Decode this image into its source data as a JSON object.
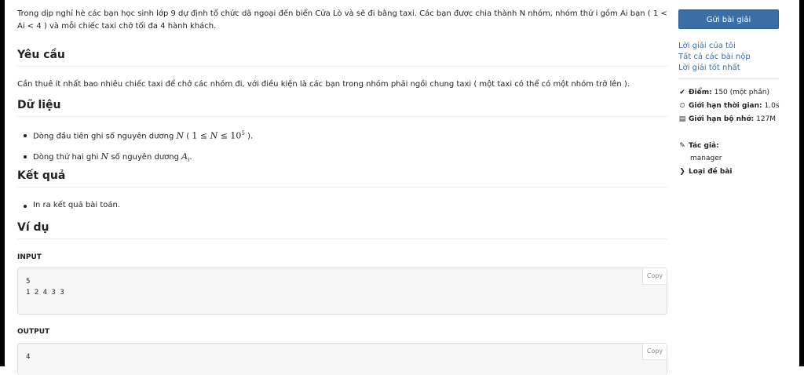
{
  "problem": {
    "intro": "Trong dịp nghỉ hè các bạn học sinh lớp 9 dự định tổ chức dã ngoại đến biển Cửa Lò và sẽ đi bằng taxi. Các bạn được chia thành N nhóm, nhóm thứ i gồm Ai bạn ( 1 < Ai < 4 ) và mỗi chiếc taxi chở tối đa 4 hành khách.",
    "req_heading": "Yêu cầu",
    "req_text": "Cần thuê ít nhất bao nhiêu chiếc taxi để chở các nhóm đi, với điều kiện là các bạn trong nhóm phải ngồi chung taxi ( một taxi có thể có một nhóm trở lên ).",
    "data_heading": "Dữ liệu",
    "data_line1_pre": "Dòng đầu tiên ghi số nguyên dương",
    "data_line1_var": "N",
    "data_line1_paren_open": " ( ",
    "data_line1_math": "1 ≤ ",
    "data_line1_math2": " ≤ 10",
    "data_line1_exp": "5",
    "data_line1_end": " ).",
    "data_line2_pre": "Dòng thứ hai ghi",
    "data_line2_var": "N",
    "data_line2_mid": "số nguyên dương",
    "data_line2_var2": "A",
    "data_line2_sub": "i",
    "data_line2_end": ".",
    "result_heading": "Kết quả",
    "result_text": "In ra kết quả bài toán.",
    "example_heading": "Ví dụ",
    "input_label": "INPUT",
    "input_code": "5\n1 2 4 3 3",
    "output_label": "OUTPUT",
    "output_code": "4",
    "copy_label": "Copy"
  },
  "sidebar": {
    "submit_label": "Gửi bài giải",
    "links": [
      "Lời giải của tôi",
      "Tất cả các bài nộp",
      "Lời giải tốt nhất"
    ],
    "points_label": "Điểm:",
    "points_value": "150 (một phần)",
    "time_label": "Giới hạn thời gian:",
    "time_value": "1.0s",
    "memory_label": "Giới hạn bộ nhớ:",
    "memory_value": "127M",
    "author_label": "Tác giả:",
    "author_name": "manager",
    "type_label": "Loại đề bài"
  }
}
